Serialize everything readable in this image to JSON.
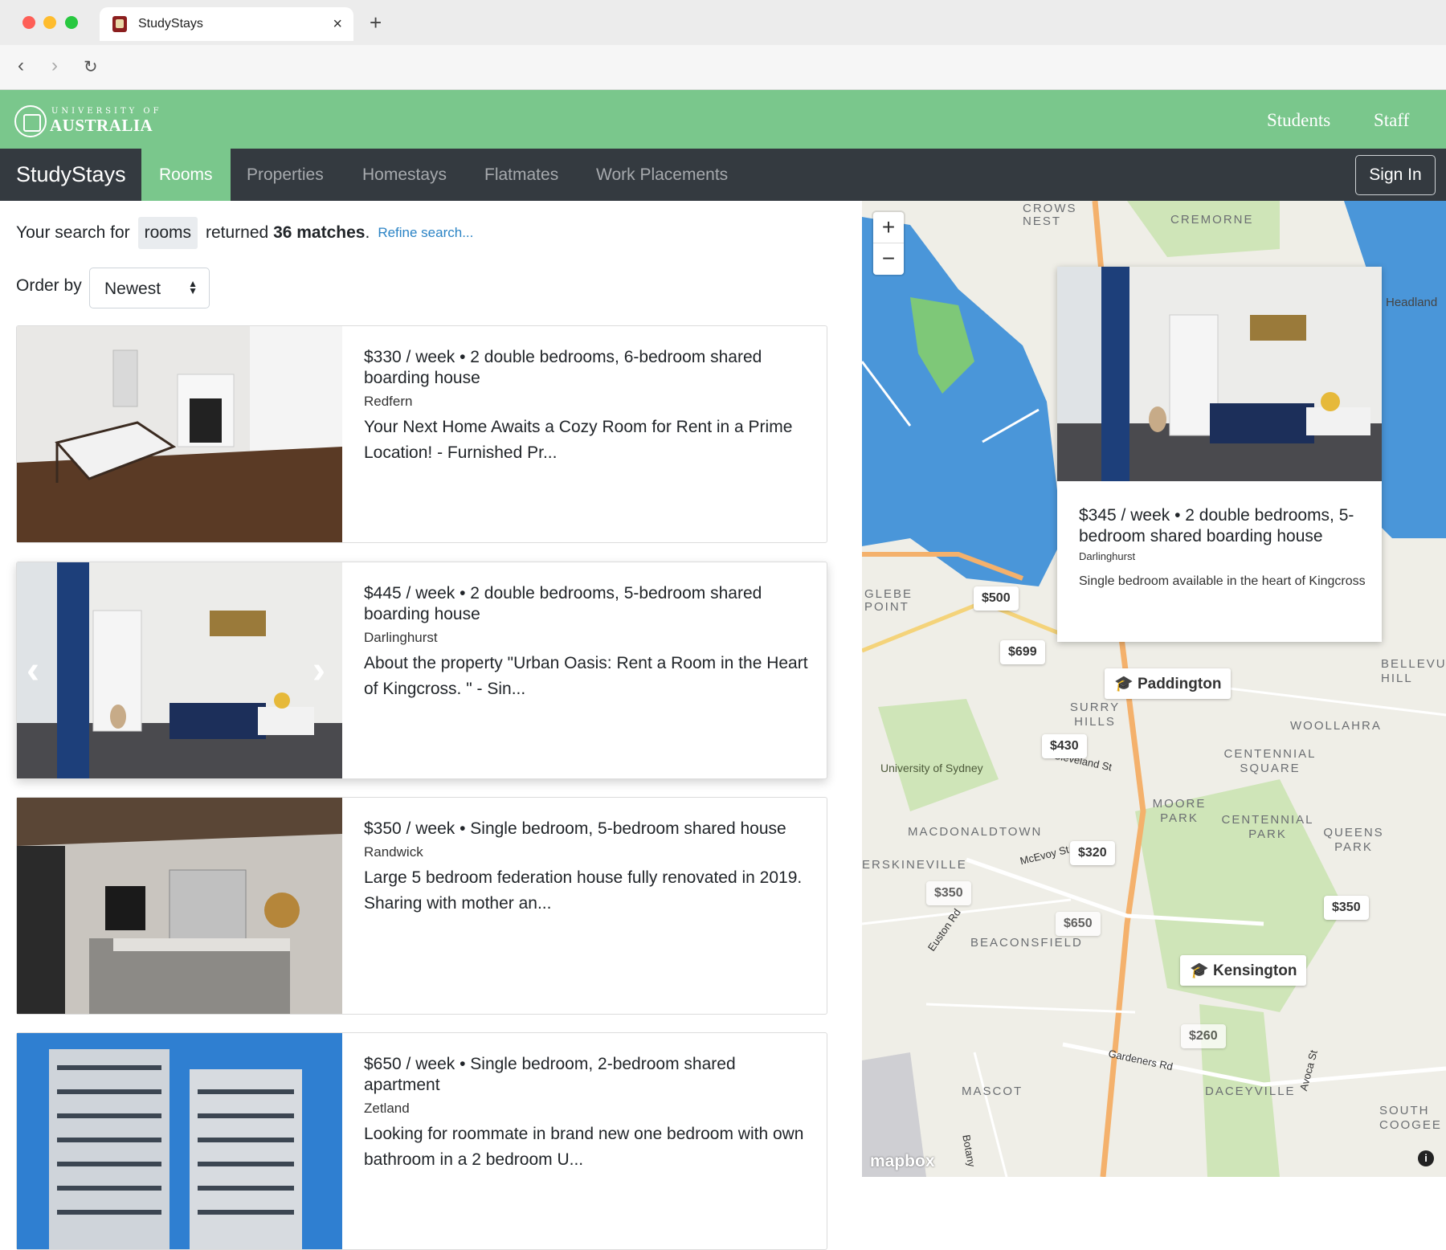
{
  "browser": {
    "tab_title": "StudyStays",
    "new_tab": "+",
    "close": "×"
  },
  "uni_header": {
    "logo_top": "UNIVERSITY OF",
    "logo_main": "AUSTRALIA",
    "links": [
      "Students",
      "Staff"
    ]
  },
  "site_nav": {
    "brand": "StudyStays",
    "items": [
      "Rooms",
      "Properties",
      "Homestays",
      "Flatmates",
      "Work Placements"
    ],
    "active": "Rooms",
    "sign_in": "Sign In"
  },
  "search": {
    "prefix": "Your search for",
    "query": "rooms",
    "returned": "returned",
    "matches": "36 matches",
    "period": ".",
    "refine": "Refine search..."
  },
  "order": {
    "label": "Order by",
    "selected": "Newest"
  },
  "listings": [
    {
      "title": "$330 / week • 2 double bedrooms, 6-bedroom shared boarding house",
      "suburb": "Redfern",
      "desc": "Your Next Home Awaits a Cozy Room for Rent in a Prime Location! - Furnished Pr..."
    },
    {
      "title": "$445 / week • 2 double bedrooms, 5-bedroom shared boarding house",
      "suburb": "Darlinghurst",
      "desc": "About the property \"Urban Oasis: Rent a Room in the Heart of Kingcross. \" - Sin..."
    },
    {
      "title": "$350 / week • Single bedroom, 5-bedroom shared house",
      "suburb": "Randwick",
      "desc": "Large 5 bedroom federation house fully renovated in 2019. Sharing with mother an..."
    },
    {
      "title": "$650 / week • Single bedroom, 2-bedroom shared apartment",
      "suburb": "Zetland",
      "desc": "Looking for roommate in brand new one bedroom with own bathroom in a 2 bedroom U..."
    }
  ],
  "map": {
    "zoom_in": "+",
    "zoom_out": "−",
    "price_pins": [
      "$500",
      "$699",
      "$430",
      "$320",
      "$350",
      "$650",
      "$350",
      "$260"
    ],
    "campuses": [
      "Paddington",
      "Kensington"
    ],
    "labels": [
      "CREMORNE",
      "CROWS NEST",
      "Headland",
      "BELLEVUE HILL",
      "WOOLLAHRA",
      "CENTENNIAL SQUARE",
      "CENTENNIAL PARK",
      "QUEENS PARK",
      "MOORE PARK",
      "SURRY HILLS",
      "MACDONALDTOWN",
      "ERSKINEVILLE",
      "BEACONSFIELD",
      "MASCOT",
      "DACEYVILLE",
      "SOUTH COOGEE",
      "GLEBE POINT",
      "University of Sydney",
      "Cleveland St",
      "McEvoy St",
      "Euston Rd",
      "Gardeners Rd",
      "Avoca St",
      "Botany"
    ],
    "popup": {
      "title": "$345 / week • 2 double bedrooms, 5-bedroom shared boarding house",
      "suburb": "Darlinghurst",
      "desc": "Single bedroom available in the heart of Kingcross"
    },
    "attribution": "mapbox",
    "info": "i"
  }
}
